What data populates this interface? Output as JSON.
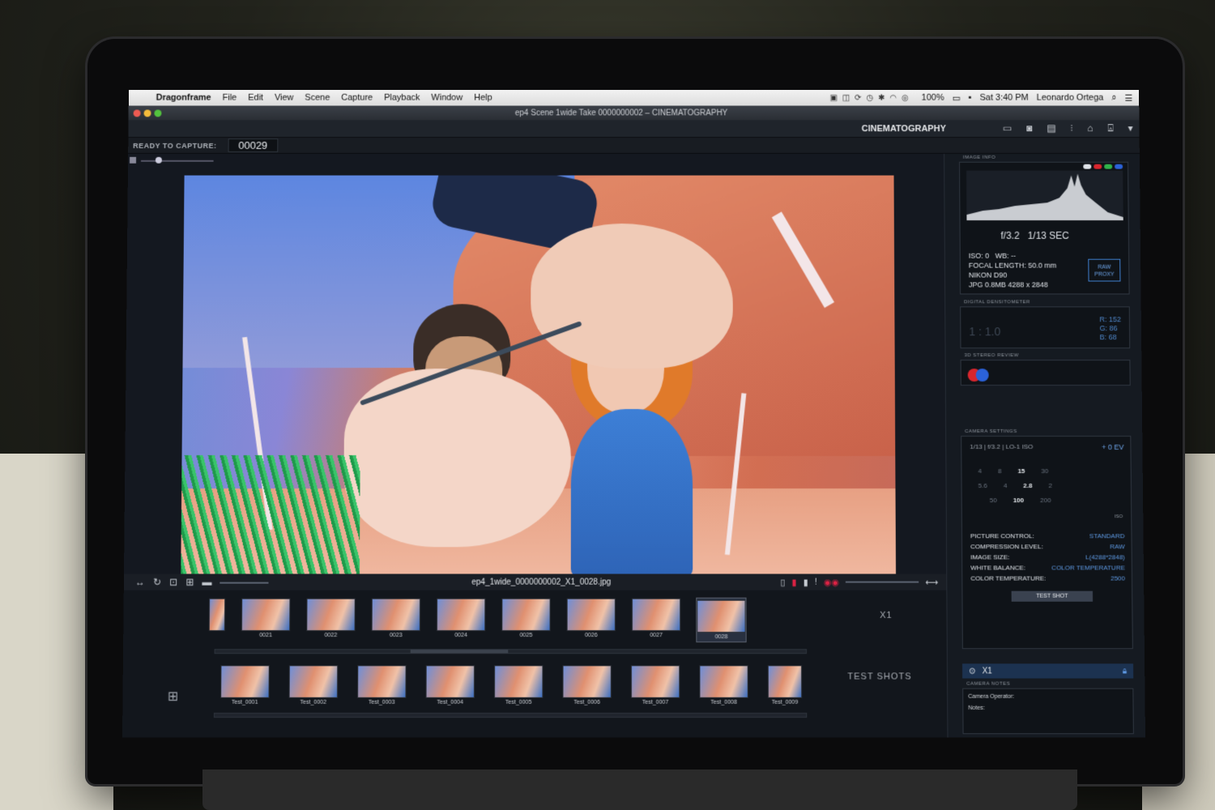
{
  "menubar": {
    "app_name": "Dragonframe",
    "items": [
      "File",
      "Edit",
      "View",
      "Scene",
      "Capture",
      "Playback",
      "Window",
      "Help"
    ],
    "battery": "100%",
    "clock": "Sat 3:40 PM",
    "user": "Leonardo Ortega"
  },
  "window": {
    "title": "ep4  Scene 1wide  Take 0000000002 – CINEMATOGRAPHY"
  },
  "workspace": {
    "label": "CINEMATOGRAPHY"
  },
  "capture": {
    "label": "READY TO CAPTURE:",
    "frame": "00029"
  },
  "viewer": {
    "filename": "ep4_1wide_0000000002_X1_0028.jpg"
  },
  "timeline": {
    "frames": [
      "0021",
      "0022",
      "0023",
      "0024",
      "0025",
      "0026",
      "0027",
      "0028"
    ],
    "exposure_label": "X1",
    "test_shots_label": "TEST SHOTS",
    "test_shots": [
      "Test_0001",
      "Test_0002",
      "Test_0003",
      "Test_0004",
      "Test_0005",
      "Test_0006",
      "Test_0007",
      "Test_0008",
      "Test_0009"
    ]
  },
  "image_info": {
    "title": "IMAGE INFO",
    "aperture": "f/3.2",
    "shutter": "1/13 SEC",
    "iso": "ISO: 0",
    "wb": "WB: --",
    "focal_length": "FOCAL LENGTH: 50.0 mm",
    "camera": "NIKON D90",
    "format": "JPG  0.8MB  4288 x 2848",
    "raw_proxy": "RAW PROXY"
  },
  "densitometer": {
    "title": "DIGITAL DENSITOMETER",
    "ratio": "1 : 1.0",
    "r": "R: 152",
    "g": "G:  86",
    "b": "B:  68"
  },
  "stereo": {
    "title": "3D STEREO REVIEW"
  },
  "camera_settings": {
    "title": "CAMERA SETTINGS",
    "summary": "1/13  |  f/3.2  |  LO-1 ISO",
    "ev": "+ 0 EV",
    "shutter_row": [
      "4",
      "8",
      "15",
      "30"
    ],
    "aperture_row": [
      "5.6",
      "4",
      "2.8",
      "2"
    ],
    "iso_row": [
      "50",
      "100",
      "200"
    ],
    "iso_label": "ISO",
    "rows": [
      {
        "key": "PICTURE CONTROL:",
        "value": "STANDARD"
      },
      {
        "key": "COMPRESSION LEVEL:",
        "value": "RAW"
      },
      {
        "key": "IMAGE SIZE:",
        "value": "L(4288*2848)"
      },
      {
        "key": "WHITE BALANCE:",
        "value": "COLOR TEMPERATURE"
      },
      {
        "key": "COLOR TEMPERATURE:",
        "value": "2500"
      }
    ],
    "test_shot": "TEST SHOT",
    "exposure": "X1"
  },
  "camera_notes": {
    "title": "CAMERA NOTES",
    "operator": "Camera Operator:",
    "notes": "Notes:"
  },
  "colors": {
    "accent": "#5e99e3",
    "panel": "#151a21",
    "menubar": "#e6e6e6"
  }
}
